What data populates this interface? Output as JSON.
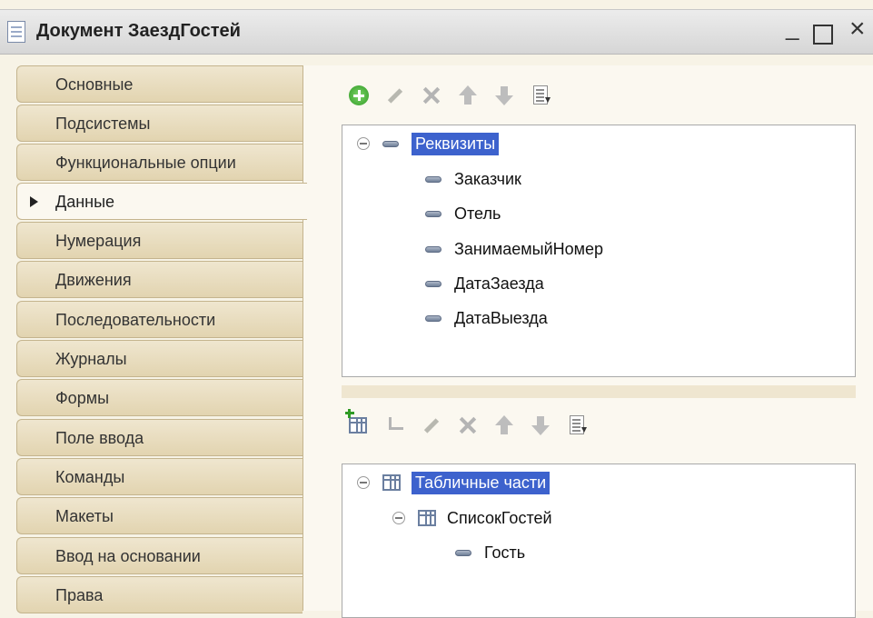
{
  "window": {
    "title": "Документ ЗаездГостей",
    "controls": {
      "minimize": "_",
      "close": "×"
    }
  },
  "sidebar": {
    "items": [
      {
        "label": "Основные"
      },
      {
        "label": "Подсистемы"
      },
      {
        "label": "Функциональные опции"
      },
      {
        "label": "Данные",
        "active": true
      },
      {
        "label": "Нумерация"
      },
      {
        "label": "Движения"
      },
      {
        "label": "Последовательности"
      },
      {
        "label": "Журналы"
      },
      {
        "label": "Формы"
      },
      {
        "label": "Поле ввода"
      },
      {
        "label": "Команды"
      },
      {
        "label": "Макеты"
      },
      {
        "label": "Ввод на основании"
      },
      {
        "label": "Права"
      }
    ]
  },
  "attributes_panel": {
    "toolbar_icons": [
      "add-circle-icon",
      "pencil-icon",
      "delete-icon",
      "move-up-icon",
      "move-down-icon",
      "list-sort-icon"
    ],
    "root": {
      "label": "Реквизиты"
    },
    "items": [
      {
        "label": "Заказчик"
      },
      {
        "label": "Отель"
      },
      {
        "label": "ЗанимаемыйНомер"
      },
      {
        "label": "ДатаЗаезда"
      },
      {
        "label": "ДатаВыезда"
      }
    ]
  },
  "tabular_panel": {
    "toolbar_icons": [
      "add-table-icon",
      "add-subitem-icon",
      "pencil-icon",
      "delete-icon",
      "move-up-icon",
      "move-down-icon",
      "list-sort-icon"
    ],
    "root": {
      "label": "Табличные части"
    },
    "table": {
      "label": "СписокГостей"
    },
    "columns": [
      {
        "label": "Гость"
      }
    ]
  },
  "colors": {
    "selection": "#3d62cd",
    "tab_background": "#e7dbbd",
    "panel_background": "#fbf8f0"
  }
}
